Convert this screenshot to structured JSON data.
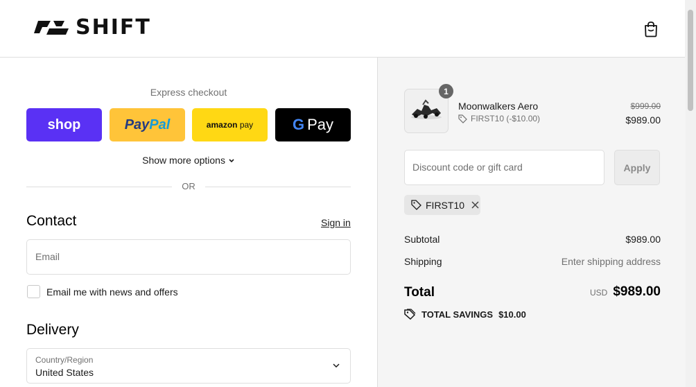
{
  "header": {
    "brand": "SHIFT",
    "cart_icon": "shopping-bag-icon"
  },
  "express": {
    "title": "Express checkout",
    "buttons": {
      "shop": "shop",
      "paypal_a": "Pay",
      "paypal_b": "Pal",
      "amazon_a": "amazon",
      "amazon_b": "pay",
      "gpay_g": "G",
      "gpay_pay": "Pay"
    },
    "more_options": "Show more options",
    "divider": "OR"
  },
  "contact": {
    "title": "Contact",
    "signin": "Sign in",
    "email_placeholder": "Email",
    "newsletter_label": "Email me with news and offers"
  },
  "delivery": {
    "title": "Delivery",
    "country_label": "Country/Region",
    "country_value": "United States"
  },
  "summary": {
    "quantity": "1",
    "product_name": "Moonwalkers Aero",
    "product_discount": "FIRST10 (-$10.00)",
    "price_original": "$999.00",
    "price_current": "$989.00",
    "discount_placeholder": "Discount code or gift card",
    "apply_label": "Apply",
    "applied_code": "FIRST10",
    "subtotal_label": "Subtotal",
    "subtotal_value": "$989.00",
    "shipping_label": "Shipping",
    "shipping_value": "Enter shipping address",
    "total_label": "Total",
    "currency": "USD",
    "total_value": "$989.00",
    "savings_label": "TOTAL SAVINGS",
    "savings_value": "$10.00"
  },
  "colors": {
    "shop": "#5a31f4",
    "paypal": "#ffc439",
    "amazon": "#ffd814",
    "gpay": "#000000",
    "summary_bg": "#f5f5f5"
  }
}
